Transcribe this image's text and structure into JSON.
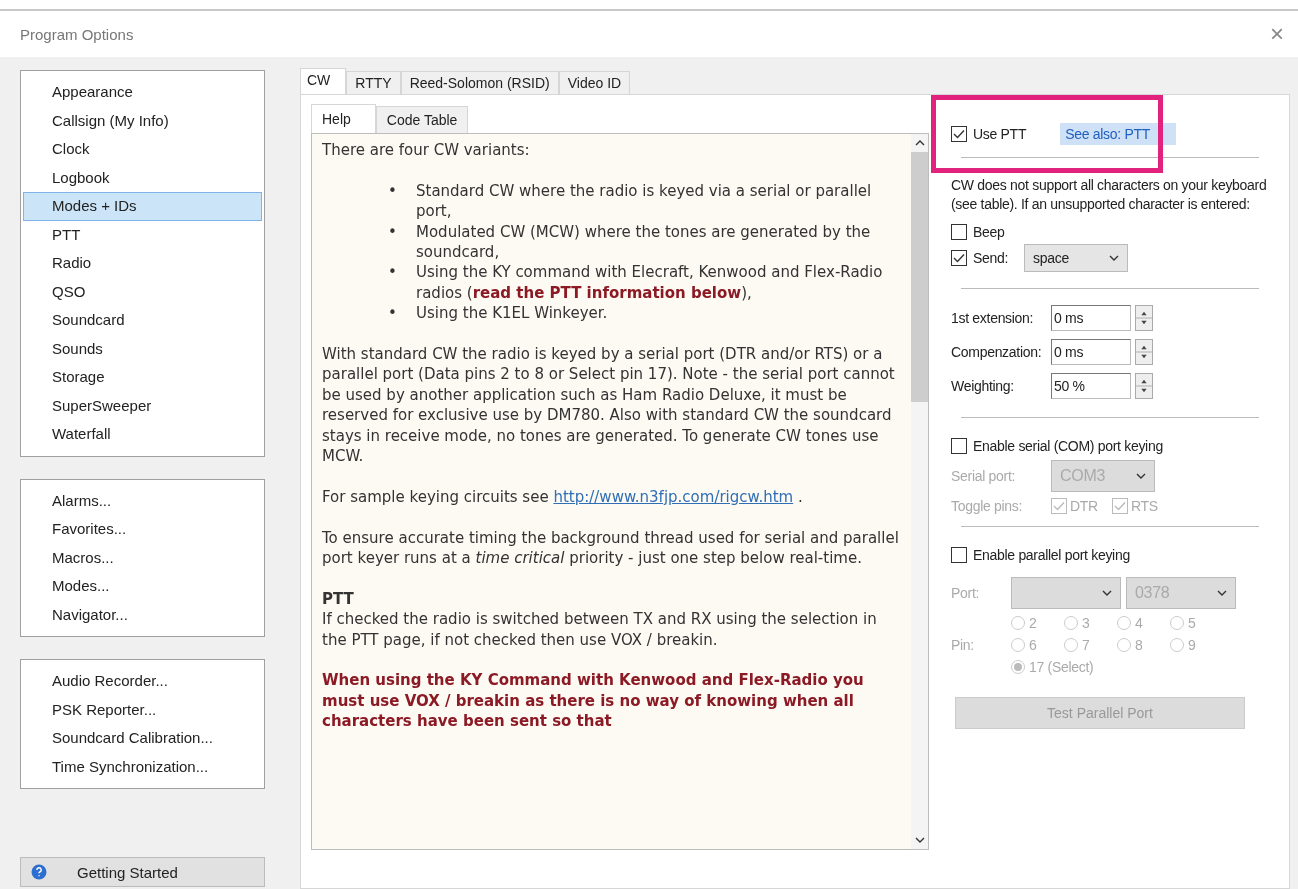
{
  "window": {
    "title": "Program Options",
    "close": "×"
  },
  "sidebar": {
    "groups": [
      {
        "items": [
          {
            "label": "Appearance",
            "selected": false
          },
          {
            "label": "Callsign (My Info)",
            "selected": false
          },
          {
            "label": "Clock",
            "selected": false
          },
          {
            "label": "Logbook",
            "selected": false
          },
          {
            "label": "Modes + IDs",
            "selected": true
          },
          {
            "label": "PTT",
            "selected": false
          },
          {
            "label": "Radio",
            "selected": false
          },
          {
            "label": "QSO",
            "selected": false
          },
          {
            "label": "Soundcard",
            "selected": false
          },
          {
            "label": "Sounds",
            "selected": false
          },
          {
            "label": "Storage",
            "selected": false
          },
          {
            "label": "SuperSweeper",
            "selected": false
          },
          {
            "label": "Waterfall",
            "selected": false
          }
        ]
      },
      {
        "items": [
          {
            "label": "Alarms...",
            "selected": false
          },
          {
            "label": "Favorites...",
            "selected": false
          },
          {
            "label": "Macros...",
            "selected": false
          },
          {
            "label": "Modes...",
            "selected": false
          },
          {
            "label": "Navigator...",
            "selected": false
          }
        ]
      },
      {
        "items": [
          {
            "label": "Audio Recorder...",
            "selected": false
          },
          {
            "label": "PSK Reporter...",
            "selected": false
          },
          {
            "label": "Soundcard Calibration...",
            "selected": false
          },
          {
            "label": "Time Synchronization...",
            "selected": false
          }
        ]
      }
    ],
    "getting_started": "Getting Started"
  },
  "tabs": [
    {
      "label": "CW",
      "selected": true
    },
    {
      "label": "RTTY",
      "selected": false
    },
    {
      "label": "Reed-Solomon (RSID)",
      "selected": false
    },
    {
      "label": "Video ID",
      "selected": false
    }
  ],
  "subtabs": [
    {
      "label": "Help",
      "selected": true
    },
    {
      "label": "Code Table",
      "selected": false
    }
  ],
  "help": [
    {
      "kind": "text",
      "text": "There are four CW variants:"
    },
    {
      "kind": "bullets",
      "bullet": "•",
      "items": [
        "Standard CW where the radio is keyed via a serial or parallel port,",
        "Modulated CW (MCW) where the tones are generated by the soundcard,",
        "Using the KY command with Elecraft, Kenwood and Flex-Radio radios (**read the PTT information below**),",
        "Using the K1EL Winkeyer."
      ]
    },
    {
      "kind": "text",
      "text": "With standard CW the radio is keyed by a serial port (DTR and/or RTS) or a parallel port (Data pins 2 to 8 or Select pin 17). Note - the serial port cannot be used by another application such as Ham Radio Deluxe, it must be reserved for exclusive use by DM780. Also with standard CW the soundcard stays in receive mode, no tones are generated. To generate CW tones use MCW."
    },
    {
      "kind": "link",
      "text": "For sample keying circuits see",
      "link": "http://www.n3fjp.com/rigcw.htm",
      "after": "."
    },
    {
      "kind": "text",
      "text": "To ensure accurate timing the background thread used for serial and parallel port keyer runs at a *time critical* priority - just one step below real-time."
    },
    {
      "kind": "heading",
      "title": "PTT",
      "text": "If checked the radio is switched between TX and RX using the selection in the PTT page, if not checked then use VOX / breakin."
    },
    {
      "kind": "warning",
      "text": "When using the KY Command with Kenwood and Flex-Radio you must use VOX / breakin as there is no way of knowing when all characters have been sent so that"
    }
  ],
  "options": {
    "use_ptt": {
      "label": "Use PTT",
      "checked": true,
      "link": "See also: PTT",
      "highlighted": true
    },
    "note": "CW does not support all characters on your keyboard (see table). If an unsupported character  is entered:",
    "beep": {
      "label": "Beep",
      "checked": false
    },
    "send": {
      "label": "Send:",
      "checked": true,
      "value": "space"
    },
    "spinners": [
      {
        "label": "1st extension:",
        "value": "0 ms"
      },
      {
        "label": "Compenzation:",
        "value": "0 ms"
      },
      {
        "label": "Weighting:",
        "value": "50 %"
      }
    ],
    "serial": {
      "label": "Enable serial (COM) port keying",
      "checked": false,
      "port_label": "Serial port:",
      "port": "COM3",
      "pins_label": "Toggle pins:",
      "pins": [
        {
          "label": "DTR",
          "checked": true
        },
        {
          "label": "RTS",
          "checked": true
        }
      ],
      "disabled": true
    },
    "parallel": {
      "label": "Enable parallel port keying",
      "checked": false,
      "port_label": "Port:",
      "address": "0378",
      "pin_label": "Pin:",
      "pins": [
        {
          "label": "2",
          "selected": false
        },
        {
          "label": "3",
          "selected": false
        },
        {
          "label": "4",
          "selected": false
        },
        {
          "label": "5",
          "selected": false
        },
        {
          "label": "6",
          "selected": false
        },
        {
          "label": "7",
          "selected": false
        },
        {
          "label": "8",
          "selected": false
        },
        {
          "label": "9",
          "selected": false
        },
        {
          "label": "17 (Select)",
          "selected": true
        }
      ],
      "disabled": true
    },
    "test_button": {
      "label": "Test Parallel Port",
      "disabled": true
    }
  }
}
